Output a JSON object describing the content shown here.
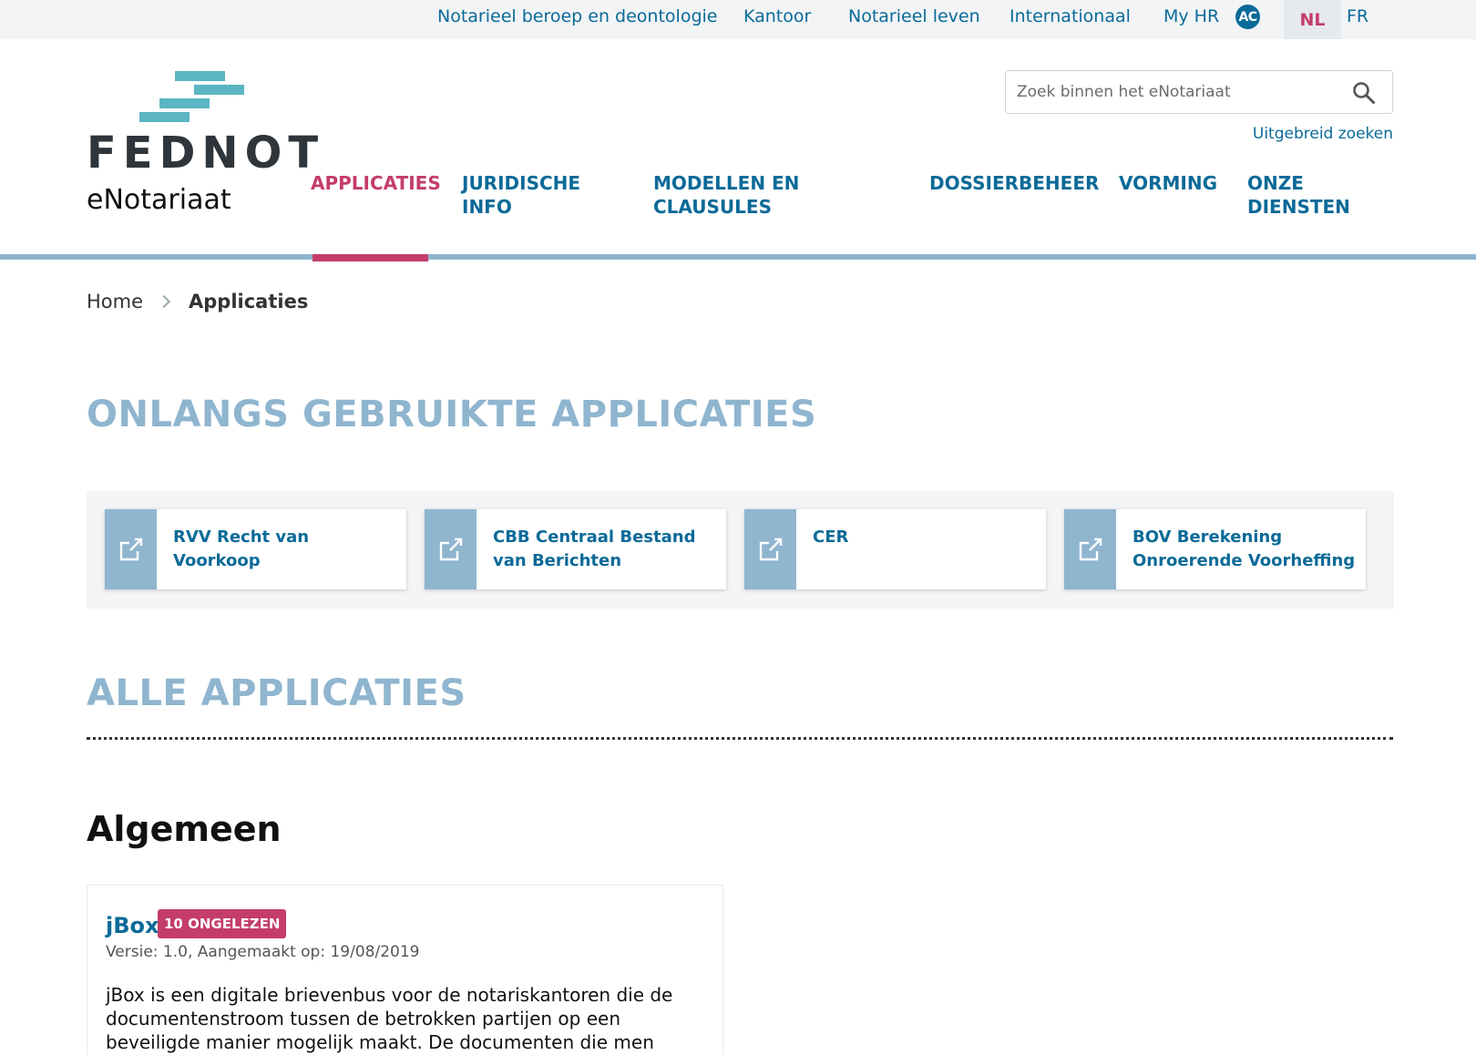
{
  "topbar": {
    "links": [
      "Notarieel beroep en deontologie",
      "Kantoor",
      "Notarieel leven",
      "Internationaal",
      "My HR"
    ],
    "avatar": "AC",
    "lang_active": "NL",
    "lang_other": "FR"
  },
  "header": {
    "brand": "FEDNOT",
    "subtitle": "eNotariaat",
    "search_placeholder": "Zoek binnen het eNotariaat",
    "advanced_search": "Uitgebreid zoeken"
  },
  "nav": {
    "items": [
      "APPLICATIES",
      "JURIDISCHE INFO",
      "MODELLEN EN CLAUSULES",
      "DOSSIERBEHEER",
      "VORMING",
      "ONZE DIENSTEN"
    ],
    "active": "APPLICATIES"
  },
  "breadcrumb": {
    "home": "Home",
    "current": "Applicaties"
  },
  "recent": {
    "title": "ONLANGS GEBRUIKTE APPLICATIES",
    "apps": [
      "RVV Recht van Voorkoop",
      "CBB Centraal Bestand van Berichten",
      "CER",
      "BOV Berekening Onroerende Voorheffing"
    ]
  },
  "all": {
    "title": "ALLE APPLICATIES",
    "category": "Algemeen",
    "app": {
      "name": "jBox",
      "badge": "10 ONGELEZEN",
      "meta": "Versie: 1.0, Aangemaakt op: 19/08/2019",
      "description": "jBox is een digitale brievenbus voor de notariskantoren die de documentenstroom tussen de betrokken partijen op een beveiligde manier mogelijk maakt. De documenten die men"
    }
  },
  "colors": {
    "primary": "#0b6a98",
    "accent": "#c43c6a",
    "light_blue": "#8fb5cf",
    "logo_teal": "#5bb5c2"
  },
  "icons": {
    "search": "search-icon",
    "external_link": "external-link-icon"
  }
}
